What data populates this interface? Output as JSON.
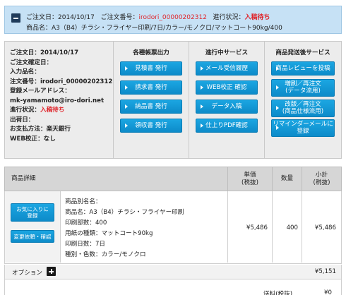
{
  "header": {
    "order_date_label": "ご注文日：",
    "order_date": "2014/10/17",
    "order_no_label": "ご注文番号：",
    "order_no": "irodori_00000202312",
    "status_label": "進行状況：",
    "status": "入稿待ち",
    "product_name_label": "商品名：",
    "product_name": "A3（B4）チラシ・フライヤー印刷/7日/カラー/モノクロ/マットコート90kg/400"
  },
  "info": {
    "order_date": "ご注文日：2014/10/17",
    "confirm_date": "ご注文確定日：",
    "submitter": "入力品名：",
    "order_no": "注文番号：irodori_00000202312",
    "email_label": "登録メールアドレス：",
    "email": "mk-yamamoto@iro-dori.net",
    "status_label": "進行状況：",
    "status": "入稿待ち",
    "ship_date": "出荷日：",
    "payment": "お支払方法：楽天銀行",
    "web_proof": "WEB校正：なし"
  },
  "columns": {
    "docs_title": "各種帳票出力",
    "docs": [
      "見積書 発行",
      "請求書 発行",
      "納品書 発行",
      "領収書 発行"
    ],
    "progress_title": "進行中サービス",
    "progress": [
      "メール受信履歴",
      "WEB校正 確認",
      "データ入稿",
      "仕上りPDF確認"
    ],
    "after_title": "商品発送後サービス",
    "after": [
      {
        "l1": "商品レビューを投稿",
        "l2": ""
      },
      {
        "l1": "増刷／再注文",
        "l2": "(データ流用)"
      },
      {
        "l1": "改版／再注文",
        "l2": "(商品仕様流用)"
      },
      {
        "l1": "リマインダーメールに",
        "l2": "登録"
      }
    ]
  },
  "table": {
    "h_detail": "商品詳細",
    "h_price_1": "単価",
    "h_price_2": "(税抜)",
    "h_qty": "数量",
    "h_subtotal_1": "小計",
    "h_subtotal_2": "(税抜)"
  },
  "row": {
    "fav_1": "お気に入りに",
    "fav_2": "登録",
    "change": "変更依頼・確認",
    "alias": "商品別名名：",
    "name": "商品名：A3（B4）チラシ・フライヤー印刷",
    "copies": "印刷部数：400",
    "paper": "用紙の種類：マットコート90kg",
    "days": "印刷日数：7日",
    "color": "種別・色数：カラー/モノクロ",
    "unit_price": "¥5,486",
    "qty": "400",
    "subtotal": "¥5,486"
  },
  "option": {
    "label": "オプション",
    "total": "¥5,151"
  },
  "shipping": {
    "label": "送料(税抜)",
    "value": "¥0"
  }
}
